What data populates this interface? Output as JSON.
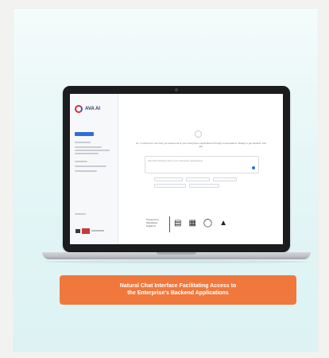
{
  "app": {
    "logo_text": "AVA AI",
    "intro_text": "Hi, I'm AVA and I can help you access all of your enterprise's applications through conversations. Ready to get started? Just ask.",
    "chat_placeholder": "Ask AVA anything about your enterprise applications"
  },
  "brand": {
    "lines": [
      "Powered by",
      "MetaSploit",
      "Digital AI"
    ],
    "icons": [
      "chart-icon",
      "document-icon",
      "people-icon",
      "cloud-icon"
    ]
  },
  "caption": {
    "line1": "Natural Chat Interface Facilitating Access to",
    "line2": "the Enterprise's Backend Applications"
  },
  "colors": {
    "caption_bg": "#f0783c",
    "accent": "#2f6fd8",
    "logo_red": "#d4303a"
  }
}
